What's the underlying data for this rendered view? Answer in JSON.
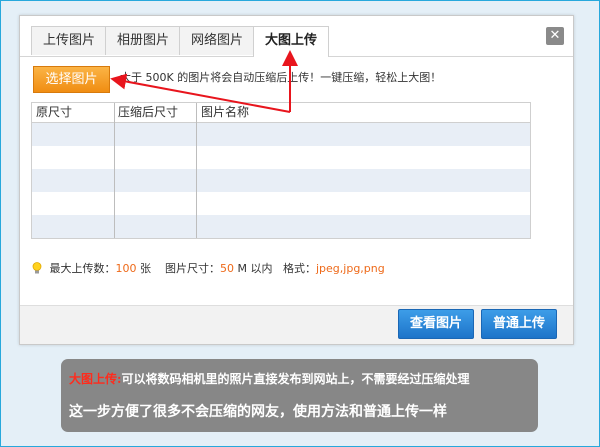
{
  "tabs": [
    {
      "label": "上传图片"
    },
    {
      "label": "相册图片"
    },
    {
      "label": "网络图片"
    },
    {
      "label": "大图上传",
      "active": true
    }
  ],
  "close_icon": "close-icon",
  "choose_button": "选择图片",
  "hint_text": "大于 500K 的图片将会自动压缩后上传！一键压缩，轻松上大图！",
  "table": {
    "columns": [
      "原尺寸",
      "压缩后尺寸",
      "图片名称"
    ],
    "rows": []
  },
  "limits": {
    "max_count_label": "最大上传数：",
    "max_count_value": "100",
    "max_count_unit": "张",
    "size_label": "图片尺寸：",
    "size_value": "50",
    "size_unit": "M 以内",
    "format_label": "格式：",
    "format_value": "jpeg,jpg,png"
  },
  "buttons": {
    "view": "查看图片",
    "normal_upload": "普通上传"
  },
  "caption": {
    "highlight": "大图上传:",
    "line1": "可以将数码相机里的照片直接发布到网站上，不需要经过压缩处理",
    "line2": "这一步方便了很多不会压缩的网友，使用方法和普通上传一样"
  },
  "colors": {
    "accent_orange": "#f08d12",
    "button_blue": "#1d74c9",
    "arrow_red": "#e8151d",
    "number_orange": "#ee6a1a",
    "caption_bg": "#878787",
    "caption_highlight": "#ff2b1c"
  }
}
